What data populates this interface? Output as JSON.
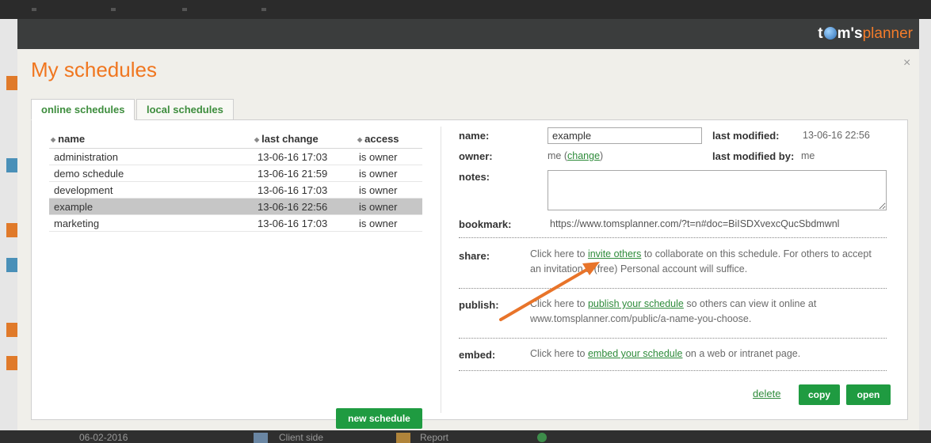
{
  "background": {
    "bottom_bar": {
      "date": "06-02-2016",
      "item1": "Client side",
      "item2": "Report"
    }
  },
  "logo": {
    "part1": "t",
    "part2": "m's",
    "part3": "planner"
  },
  "dialog": {
    "title": "My schedules",
    "close": "×",
    "tabs": [
      {
        "label": "online schedules",
        "active": true
      },
      {
        "label": "local schedules",
        "active": false
      }
    ]
  },
  "schedules": {
    "columns": {
      "name": "name",
      "last_change": "last change",
      "access": "access"
    },
    "rows": [
      {
        "name": "administration",
        "last_change": "13-06-16 17:03",
        "access": "is owner",
        "selected": false
      },
      {
        "name": "demo schedule",
        "last_change": "13-06-16 21:59",
        "access": "is owner",
        "selected": false
      },
      {
        "name": "development",
        "last_change": "13-06-16 17:03",
        "access": "is owner",
        "selected": false
      },
      {
        "name": "example",
        "last_change": "13-06-16 22:56",
        "access": "is owner",
        "selected": true
      },
      {
        "name": "marketing",
        "last_change": "13-06-16 17:03",
        "access": "is owner",
        "selected": false
      }
    ],
    "new_button": "new schedule"
  },
  "details": {
    "name_label": "name:",
    "name_value": "example",
    "last_modified_label": "last modified:",
    "last_modified_value": "13-06-16 22:56",
    "owner_label": "owner:",
    "owner_value": "me",
    "owner_change_link": "change",
    "last_modified_by_label": "last modified by:",
    "last_modified_by_value": "me",
    "notes_label": "notes:",
    "notes_value": "",
    "bookmark_label": "bookmark:",
    "bookmark_value": "https://www.tomsplanner.com/?t=n#doc=BiISDXvexcQucSbdmwnl",
    "share_label": "share:",
    "share_pre": "Click here to ",
    "share_link": "invite others",
    "share_post": " to collaborate on this schedule. For others to accept an invitation a (free) Personal account will suffice.",
    "publish_label": "publish:",
    "publish_pre": "Click here to ",
    "publish_link": "publish your schedule",
    "publish_post": " so others can view it online at www.tomsplanner.com/public/a-name-you-choose.",
    "embed_label": "embed:",
    "embed_pre": "Click here to ",
    "embed_link": "embed your schedule",
    "embed_post": " on a web or intranet page.",
    "delete_link": "delete",
    "copy_button": "copy",
    "open_button": "open"
  },
  "colors": {
    "accent_orange": "#f0761f",
    "link_green": "#2e8b3a",
    "button_green": "#1f9b41",
    "selected_row": "#c6c6c6"
  }
}
